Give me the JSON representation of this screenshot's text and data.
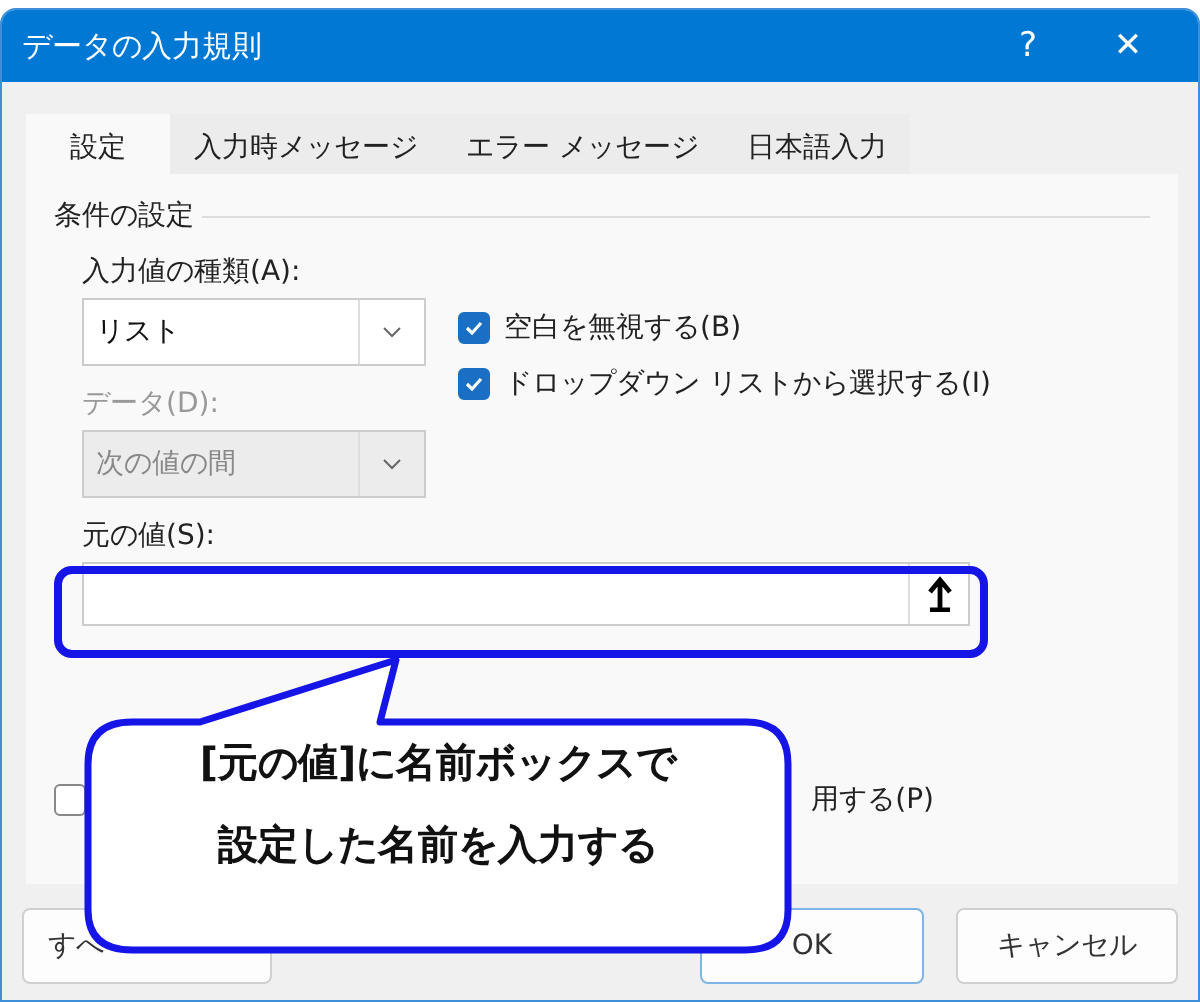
{
  "window": {
    "title": "データの入力規則",
    "help": "?",
    "close": "✕"
  },
  "tabs": [
    {
      "label": "設定",
      "selected": true
    },
    {
      "label": "入力時メッセージ",
      "selected": false
    },
    {
      "label": "エラー メッセージ",
      "selected": false
    },
    {
      "label": "日本語入力",
      "selected": false
    }
  ],
  "group": {
    "title": "条件の設定"
  },
  "type_label": "入力値の種類(A):",
  "type_select": {
    "value": "リスト",
    "disabled": false
  },
  "data_label": {
    "text": "データ(D):",
    "disabled": true
  },
  "data_select": {
    "value": "次の値の間",
    "disabled": true
  },
  "checkboxes": [
    {
      "label": "空白を無視する(B)",
      "checked": true
    },
    {
      "label": "ドロップダウン リストから選択する(I)",
      "checked": true
    }
  ],
  "source_label": "元の値(S):",
  "apply_checkbox": {
    "label": "用する(P)",
    "checked": false
  },
  "buttons": [
    {
      "kind": "clear",
      "label": "すべ"
    },
    {
      "kind": "ok",
      "label": "OK"
    },
    {
      "kind": "cancel",
      "label": "キャンセル"
    }
  ],
  "callout": {
    "lines": [
      "[元の値]に名前ボックスで",
      "設定した名前を入力する"
    ]
  }
}
